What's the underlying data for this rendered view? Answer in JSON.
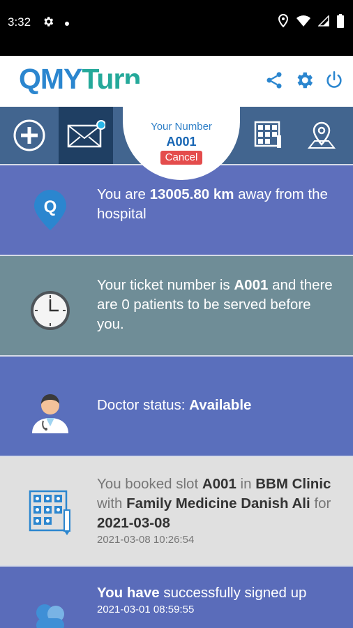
{
  "status_bar": {
    "time": "3:32"
  },
  "app": {
    "logo_part1": "Q",
    "logo_part2": "MY",
    "logo_part3": "Turn"
  },
  "ticket": {
    "label": "Your Number",
    "number": "A001",
    "cancel_label": "Cancel"
  },
  "cards": [
    {
      "pre": "You are ",
      "bold": "13005.80 km",
      "post": " away from the hospital"
    },
    {
      "pre": "Your ticket number is ",
      "bold": "A001",
      "post": " and there are 0 patients to be served before you."
    },
    {
      "pre": "Doctor status: ",
      "bold": "Available"
    },
    {
      "t1": "You booked slot ",
      "b1": "A001",
      "t2": " in ",
      "b2": "BBM Clinic",
      "t3": " with ",
      "b3": "Family Medicine Danish Ali",
      "t4": " for ",
      "b4": "2021-03-08",
      "timestamp": "2021-03-08 10:26:54"
    },
    {
      "bold": "You have",
      "post": " successfully signed up",
      "timestamp": "2021-03-01 08:59:55"
    }
  ],
  "colors": {
    "primary": "#2b86cf",
    "tab_bar": "#42658f",
    "tab_active": "#1f3f63",
    "cancel": "#e44c4c",
    "card_blue": "#5e6fbc",
    "card_teal": "#6f8d97",
    "card_gray": "#e0e0e0"
  }
}
